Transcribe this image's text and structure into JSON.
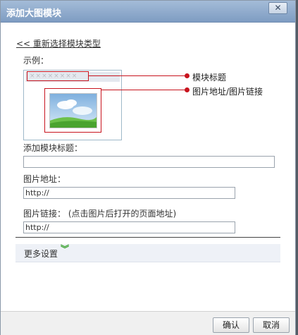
{
  "dialog": {
    "title": "添加大图模块",
    "close_icon": "✕",
    "back_link": "<< 重新选择模块类型",
    "example_label": "示例：",
    "preview": {
      "title_placeholder": "××××××××"
    },
    "callouts": {
      "title": "模块标题",
      "image": "图片地址/图片链接"
    },
    "fields": {
      "module_title": {
        "label": "添加模块标题：",
        "value": ""
      },
      "image_url": {
        "label": "图片地址：",
        "value": "http://"
      },
      "image_link": {
        "label": "图片链接：   (点击图片后打开的页面地址)",
        "value": "http://"
      }
    },
    "more_settings": "更多设置",
    "buttons": {
      "ok": "确认",
      "cancel": "取消"
    }
  },
  "colors": {
    "accent_red": "#c8141e",
    "titlebar": "#7e9cc2",
    "chevron_green": "#3aa22e"
  }
}
